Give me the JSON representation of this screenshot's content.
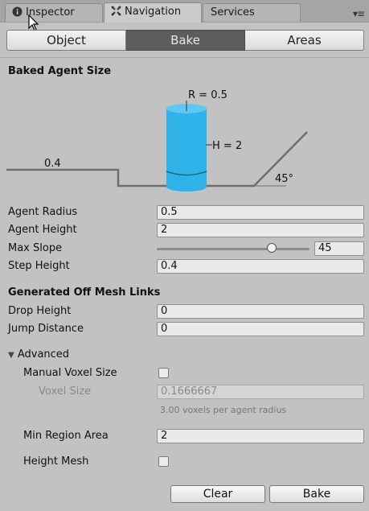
{
  "tabs": [
    {
      "label": "Inspector",
      "icon": "info-icon"
    },
    {
      "label": "Navigation",
      "icon": "navigation-icon"
    },
    {
      "label": "Services"
    }
  ],
  "toolbar": {
    "buttons": [
      "Object",
      "Bake",
      "Areas"
    ],
    "selected": "Bake"
  },
  "baked_agent_size": {
    "title": "Baked Agent Size",
    "diagram": {
      "radius_label": "R = 0.5",
      "height_label": "H = 2",
      "step_label": "0.4",
      "slope_label": "45°",
      "agent_color": "#2fb2e8"
    }
  },
  "agent": {
    "radius": {
      "label": "Agent Radius",
      "value": "0.5"
    },
    "height": {
      "label": "Agent Height",
      "value": "2"
    },
    "max_slope": {
      "label": "Max Slope",
      "value": "45",
      "slider_fraction": 0.75
    },
    "step_height": {
      "label": "Step Height",
      "value": "0.4"
    }
  },
  "offmesh": {
    "title": "Generated Off Mesh Links",
    "drop_height": {
      "label": "Drop Height",
      "value": "0"
    },
    "jump_distance": {
      "label": "Jump Distance",
      "value": "0"
    }
  },
  "advanced": {
    "title": "Advanced",
    "manual_voxel": {
      "label": "Manual Voxel Size",
      "checked": false
    },
    "voxel_size": {
      "label": "Voxel Size",
      "value": "0.1666667",
      "hint": "3.00 voxels per agent radius"
    },
    "min_region": {
      "label": "Min Region Area",
      "value": "2"
    },
    "height_mesh": {
      "label": "Height Mesh",
      "checked": false
    }
  },
  "buttons": {
    "clear": "Clear",
    "bake": "Bake"
  }
}
